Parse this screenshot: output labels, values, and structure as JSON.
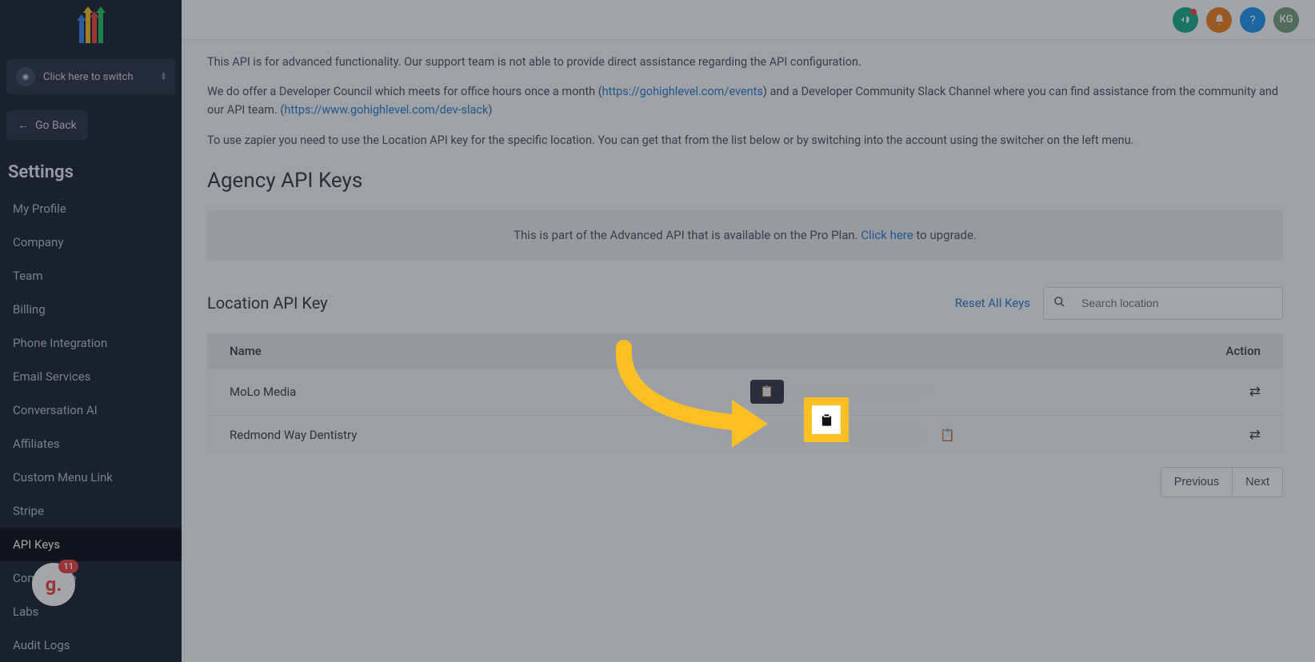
{
  "sidebar": {
    "switcher_label": "Click here to switch",
    "go_back_label": "Go Back",
    "settings_title": "Settings",
    "items": [
      {
        "label": "My Profile",
        "active": false
      },
      {
        "label": "Company",
        "active": false
      },
      {
        "label": "Team",
        "active": false
      },
      {
        "label": "Billing",
        "active": false
      },
      {
        "label": "Phone Integration",
        "active": false
      },
      {
        "label": "Email Services",
        "active": false
      },
      {
        "label": "Conversation AI",
        "active": false
      },
      {
        "label": "Affiliates",
        "active": false
      },
      {
        "label": "Custom Menu Link",
        "active": false
      },
      {
        "label": "Stripe",
        "active": false
      },
      {
        "label": "API Keys",
        "active": true
      },
      {
        "label": "Compliance",
        "active": false
      },
      {
        "label": "Labs",
        "active": false
      },
      {
        "label": "Audit Logs",
        "active": false
      }
    ],
    "badge_count": "11"
  },
  "topbar": {
    "user_initials": "KG"
  },
  "intro": {
    "p1": "This API is for advanced functionality. Our support team is not able to provide direct assistance regarding the API configuration.",
    "p2_a": "We do offer a Developer Council which meets for office hours once a month (",
    "p2_link1": "https://gohighlevel.com/events",
    "p2_b": ") and a Developer Community Slack Channel where you can find assistance from the community and our API team. (",
    "p2_link2": "https://www.gohighlevel.com/dev-slack",
    "p2_c": ")",
    "p3": "To use zapier you need to use the Location API key for the specific location. You can get that from the list below or by switching into the account using the switcher on the left menu."
  },
  "agency": {
    "title": "Agency API Keys",
    "upgrade_text_a": "This is part of the Advanced API that is available on the Pro Plan. ",
    "upgrade_link": "Click here",
    "upgrade_text_b": " to upgrade."
  },
  "location": {
    "title": "Location API Key",
    "reset_label": "Reset All Keys",
    "search_placeholder": "Search location",
    "col_name": "Name",
    "col_action": "Action",
    "rows": [
      {
        "name": "MoLo Media"
      },
      {
        "name": "Redmond Way Dentistry"
      }
    ]
  },
  "pagination": {
    "prev": "Previous",
    "next": "Next"
  },
  "colors": {
    "accent_yellow": "#fbbf24",
    "link_blue": "#2b7fd0",
    "sidebar_bg": "#1a2332"
  }
}
